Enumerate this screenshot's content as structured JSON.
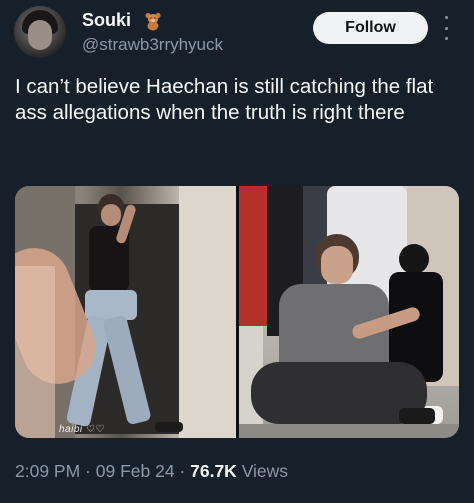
{
  "header": {
    "display_name": "Souki",
    "name_emoji_icon": "teddy-bear-icon",
    "handle": "@strawb3rryhyuck",
    "follow_label": "Follow",
    "more_icon": "more-options-icon"
  },
  "tweet": {
    "text": "I can’t believe Haechan is still catching the flat ass allegations when the truth is right there",
    "watermark": "haibi ♡♡"
  },
  "meta": {
    "time": "2:09 PM",
    "separator1": " · ",
    "date": "09 Feb 24",
    "separator2": " · ",
    "views_count": "76.7K",
    "views_label": " Views"
  },
  "colors": {
    "background": "#15202b",
    "text_primary": "#f7f9f9",
    "text_secondary": "#8b98a5",
    "follow_button_bg": "#eff3f4",
    "follow_button_text": "#0f1419"
  }
}
